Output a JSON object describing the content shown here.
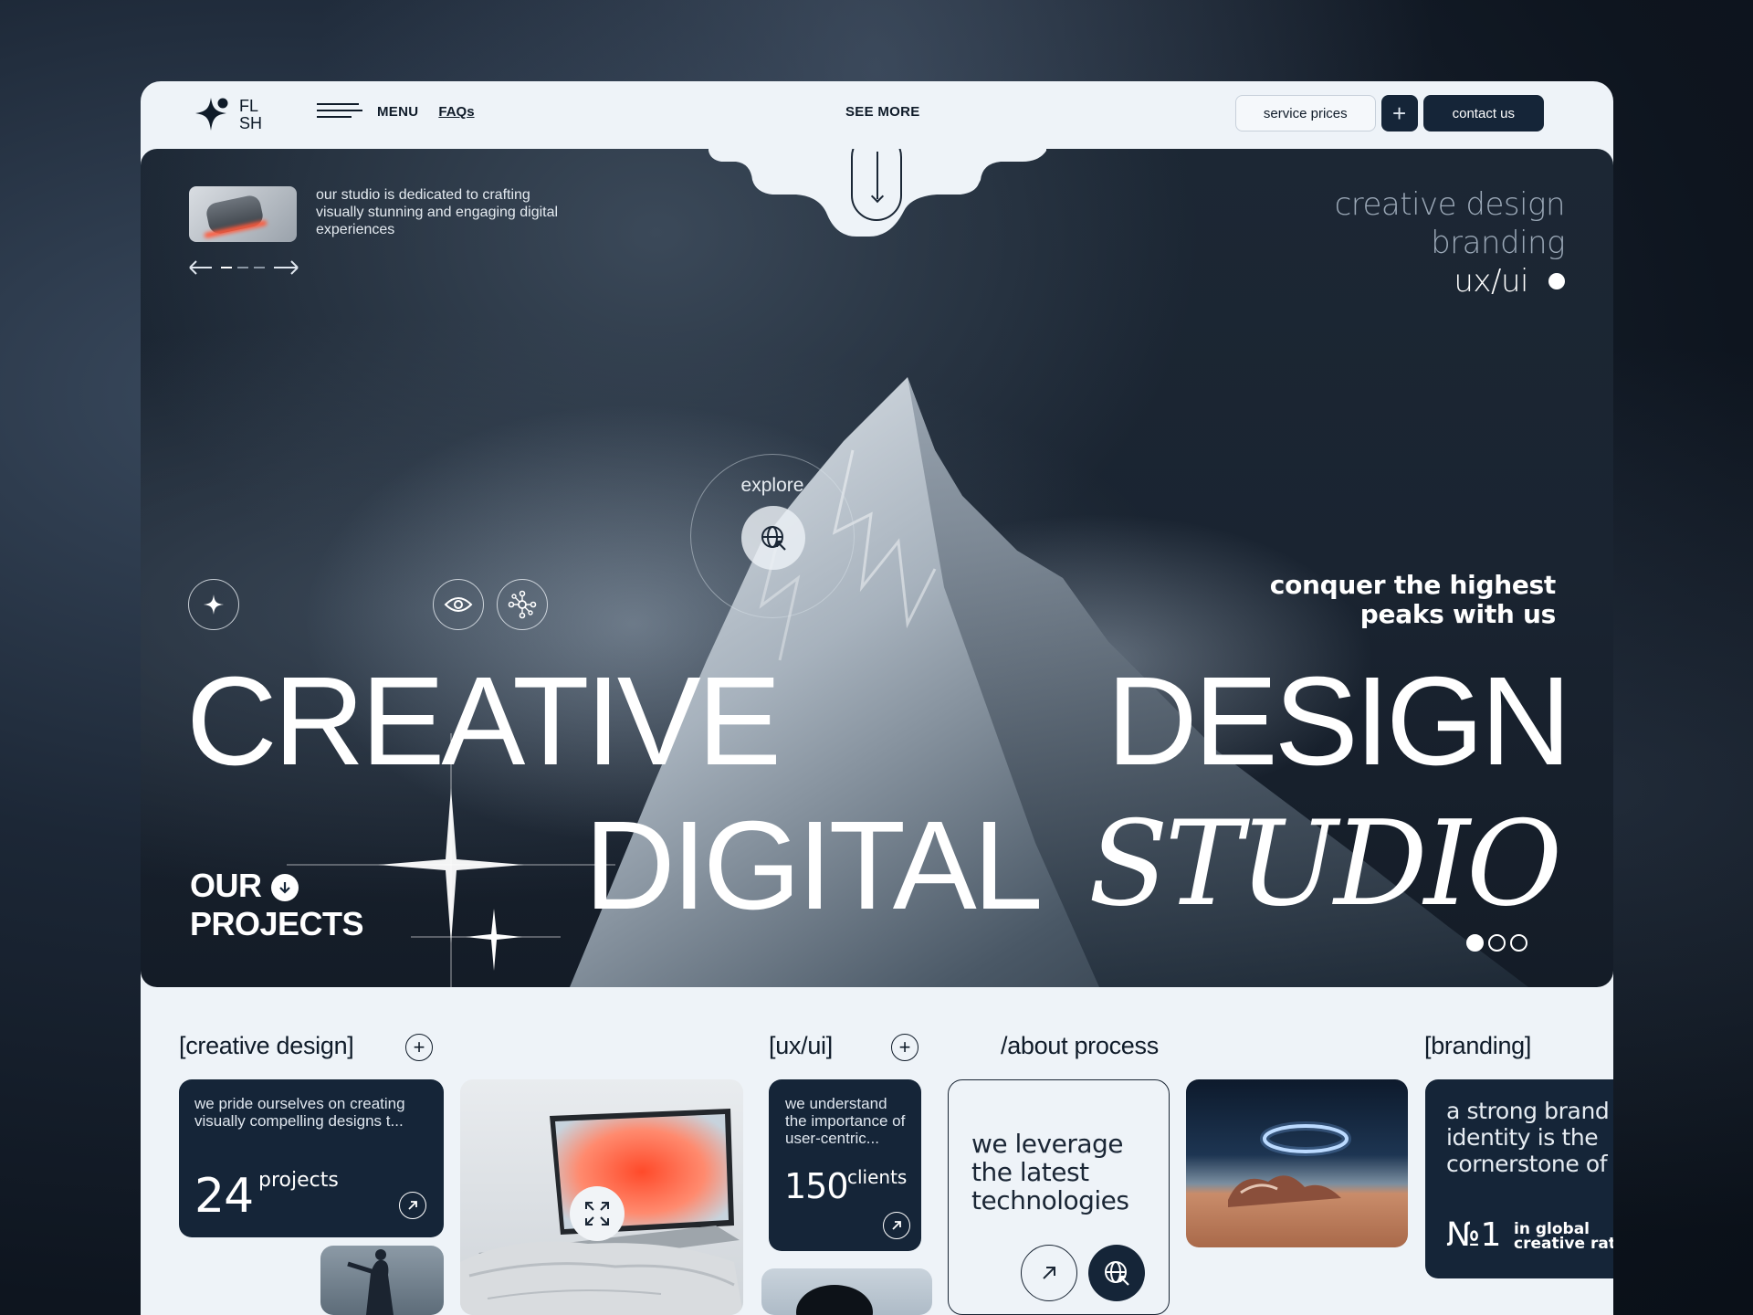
{
  "nav": {
    "logo_line1": "FL",
    "logo_line2": "SH",
    "menu_label": "MENU",
    "faqs_label": "FAQs",
    "see_more_label": "SEE MORE",
    "service_prices_label": "service prices",
    "plus_label": "+",
    "contact_label": "contact us"
  },
  "hero": {
    "intro_text": "our studio is dedicated to crafting visually stunning and engaging digital experiences",
    "services": [
      "creative design",
      "branding",
      "ux/ui"
    ],
    "explore_label": "explore",
    "tagline_line1": "conquer the highest",
    "tagline_line2": "peaks with us",
    "headline_word1": "CREATIVE",
    "headline_word2": "DESIGN",
    "headline_word3": "DIGITAL",
    "headline_word4": "STUDIO",
    "projects_line1": "OUR",
    "projects_line2": "PROJECTS",
    "pager": {
      "total": 3,
      "active": 1
    }
  },
  "sections": {
    "creative_design": "[creative design]",
    "ux_ui": "[ux/ui]",
    "about_process": "/about process",
    "branding": "[branding]"
  },
  "cards": {
    "creative": {
      "text": "we pride ourselves on creating visually compelling designs t...",
      "number": "24",
      "label": "projects"
    },
    "uxui": {
      "text": "we understand the importance of user-centric...",
      "number": "150",
      "label": "clients"
    },
    "process": {
      "text": "we leverage the latest technologies"
    },
    "branding": {
      "text": "a strong brand identity is the cornerstone of",
      "number": "№1",
      "label_line1": "in global",
      "label_line2": "creative rati"
    }
  },
  "colors": {
    "frame_bg": "#eef3f8",
    "dark_navy": "#152538",
    "text_dark": "#0f1b29",
    "accent_orange": "#ff5a3c"
  }
}
